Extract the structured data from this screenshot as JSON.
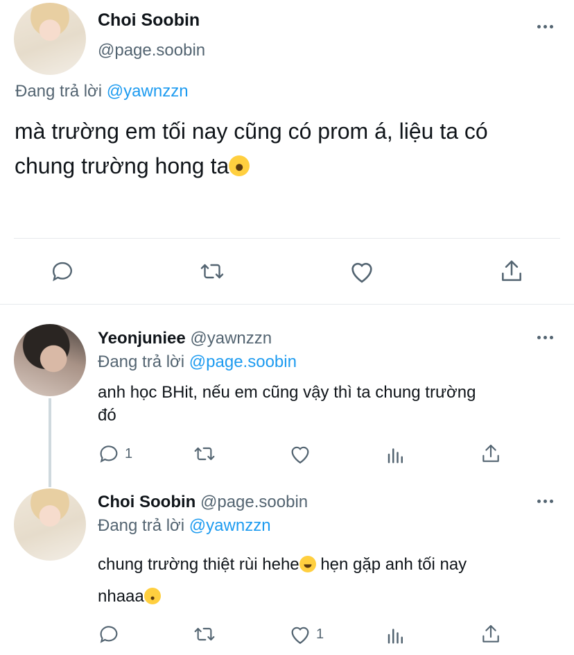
{
  "main_tweet": {
    "author_name": "Choi Soobin",
    "author_handle": "@page.soobin",
    "reply_prefix": "Đang trả lời",
    "reply_to": "@yawnzzn",
    "text_line1": "mà trường em tối nay cũng có prom á, liệu ta có",
    "text_line2": "chung trường hong ta"
  },
  "reply1": {
    "author_name": "Yeonjuniee",
    "author_handle": "@yawnzzn",
    "reply_prefix": "Đang trả lời",
    "reply_to": "@page.soobin",
    "text_line1": "anh học BHit, nếu em cũng vậy thì ta chung trường",
    "text_line2": "đó",
    "reply_count": "1"
  },
  "reply2": {
    "author_name": "Choi Soobin",
    "author_handle": "@page.soobin",
    "reply_prefix": "Đang trả lời",
    "reply_to": "@yawnzzn",
    "text_part1": "chung trường thiệt rùi hehe",
    "text_part2": " hẹn gặp anh tối nay",
    "text_line2": "nhaaa",
    "like_count": "1"
  },
  "colors": {
    "accent": "#1d9bf0",
    "icon": "#536471",
    "divider": "#e6e9ec"
  },
  "icons": [
    "more-icon",
    "reply-icon",
    "retweet-icon",
    "like-icon",
    "share-icon",
    "analytics-icon",
    "emoji-astonished",
    "emoji-grin",
    "emoji-kiss"
  ]
}
